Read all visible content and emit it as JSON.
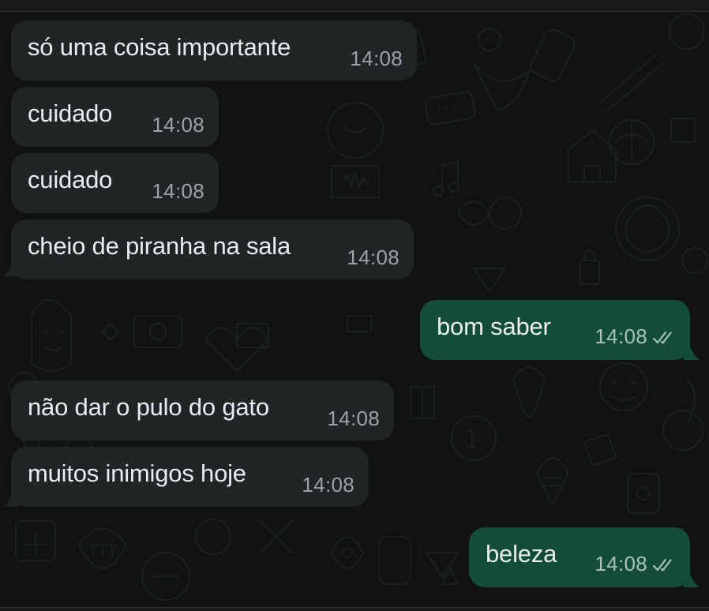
{
  "messages": [
    {
      "direction": "in",
      "text": "só uma coisa importante",
      "time": "14:08"
    },
    {
      "direction": "in",
      "text": "cuidado",
      "time": "14:08"
    },
    {
      "direction": "in",
      "text": "cuidado",
      "time": "14:08"
    },
    {
      "direction": "in",
      "text": "cheio de piranha na sala",
      "time": "14:08"
    },
    {
      "direction": "out",
      "text": "bom saber",
      "time": "14:08",
      "status": "read-double-check-icon"
    },
    {
      "direction": "in",
      "text": "não dar o pulo do gato",
      "time": "14:08"
    },
    {
      "direction": "in",
      "text": "muitos inimigos hoje",
      "time": "14:08"
    },
    {
      "direction": "out",
      "text": "beleza",
      "time": "14:08",
      "status": "read-double-check-icon"
    }
  ],
  "colors": {
    "background": "#111313",
    "incoming_bubble": "#222526",
    "outgoing_bubble": "#134d37",
    "text": "#e9edef",
    "timestamp": "#9ba3a7"
  }
}
